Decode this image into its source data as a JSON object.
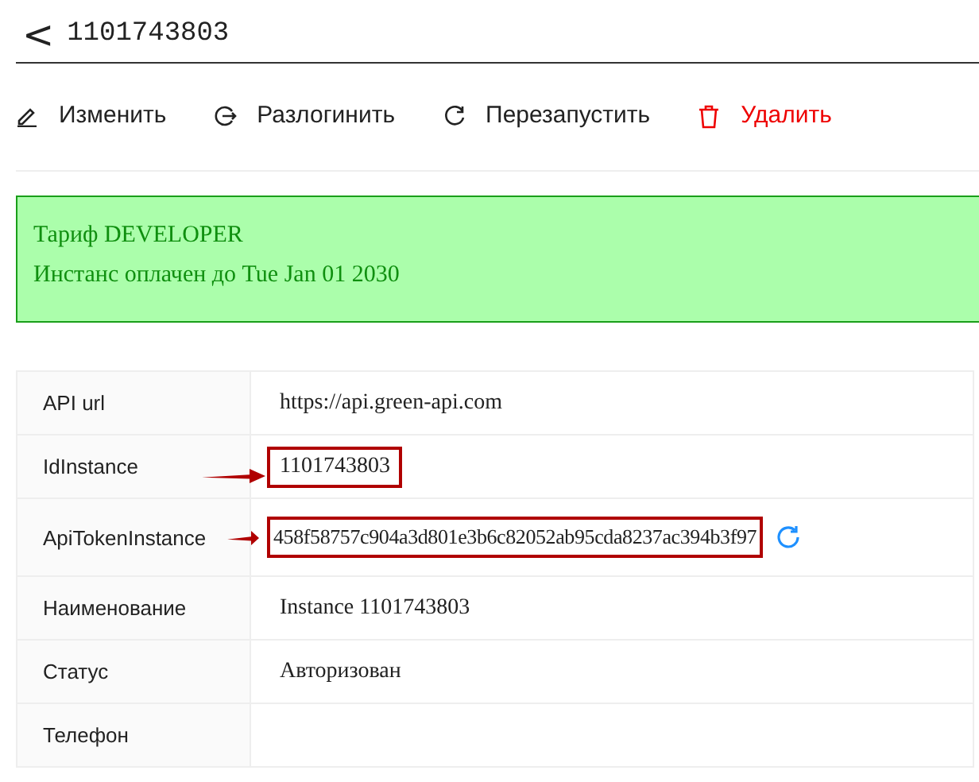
{
  "header": {
    "back": "<",
    "title": "1101743803"
  },
  "actions": [
    {
      "kind": "edit",
      "label": "Изменить"
    },
    {
      "kind": "logout",
      "label": "Разлогинить"
    },
    {
      "kind": "restart",
      "label": "Перезапустить"
    },
    {
      "kind": "delete",
      "label": "Удалить"
    }
  ],
  "notice": {
    "lines": [
      "Тариф DEVELOPER",
      "Инстанс оплачен до Tue Jan 01 2030"
    ]
  },
  "table": {
    "rows": [
      {
        "label": "API url",
        "value": "https://api.green-api.com",
        "highlighted": false,
        "refresh": false
      },
      {
        "label": "IdInstance",
        "value": "1101743803",
        "highlighted": true,
        "refresh": false
      },
      {
        "label": "ApiTokenInstance",
        "value": "458f58757c904a3d801e3b6c82052ab95cda8237ac394b3f97",
        "highlighted": true,
        "refresh": true
      },
      {
        "label": "Наименование",
        "value": "Instance 1101743803",
        "highlighted": false,
        "refresh": false
      },
      {
        "label": "Статус",
        "value": "Авторизован",
        "highlighted": false,
        "refresh": false
      },
      {
        "label": "Телефон",
        "highlighted": false,
        "refresh": false
      }
    ]
  }
}
